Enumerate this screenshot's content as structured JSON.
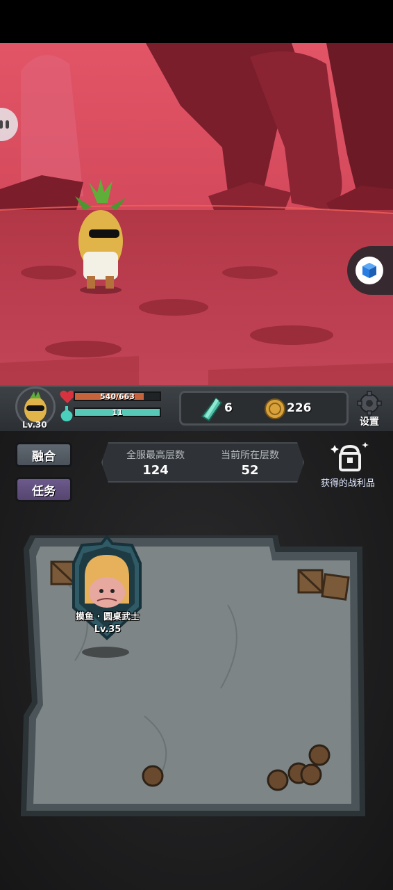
{
  "player": {
    "level": "Lv.30",
    "hp_text": "540/663",
    "hp_fraction": 0.8145,
    "mp_text": "11",
    "mp_fraction": 1.0
  },
  "currency": {
    "gems": "6",
    "coins": "226"
  },
  "settings": {
    "label": "设置"
  },
  "menu": {
    "fusion_label": "融合",
    "task_label": "任务"
  },
  "floors": {
    "server_best_label": "全服最高层数",
    "server_best_value": "124",
    "current_label": "当前所在层数",
    "current_value": "52"
  },
  "loot": {
    "label": "获得的战利品"
  },
  "enemy": {
    "name": "摸鱼 · 圆桌武士",
    "level": "Lv.35"
  },
  "colors": {
    "hp_fill": "#c4633c",
    "mp_fill": "#58c9b7",
    "scene_sky": "#d8485d",
    "scene_ground": "#b73a47"
  },
  "icons": [
    "heart-icon",
    "potion-icon",
    "gem-icon",
    "coin-icon",
    "gear-icon",
    "treasure-chest-icon",
    "cube-app-icon"
  ]
}
